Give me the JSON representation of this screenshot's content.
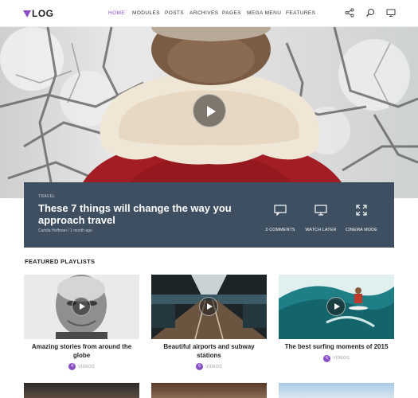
{
  "header": {
    "logo": "LOG",
    "nav": [
      "HOME",
      "MODULES",
      "POSTS",
      "ARCHIVES",
      "PAGES",
      "MEGA MENU",
      "FEATURES"
    ],
    "icons": [
      "share-icon",
      "search-icon",
      "monitor-icon"
    ]
  },
  "hero": {
    "category": "TRAVEL",
    "title": "These 7 things will change the way you approach travel",
    "author": "Camila Hoffman",
    "date": "1 month ago",
    "actions": [
      "3 COMMENTS",
      "WATCH LATER",
      "CINEMA MODE"
    ]
  },
  "playlists": {
    "heading": "FEATURED PLAYLISTS",
    "cards": [
      {
        "title": "Amazing stories from around the globe",
        "badge": "4",
        "label": "VIDEOS"
      },
      {
        "title": "Beautiful airports and subway stations",
        "badge": "6",
        "label": "VIDEOS"
      },
      {
        "title": "The best surfing moments of 2015",
        "badge": "6",
        "label": "VIDEOS"
      }
    ]
  },
  "colors": {
    "accent": "#8a4fc7",
    "infobox": "#3f4f62"
  }
}
